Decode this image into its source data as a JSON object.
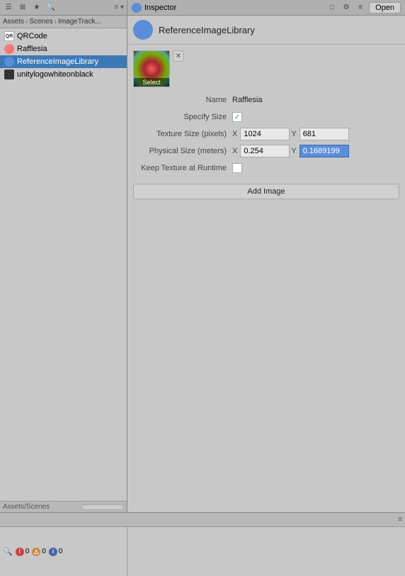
{
  "topBar": {
    "left": {
      "collapseLabel": "≡",
      "menuItems": [
        "☰",
        "⊞",
        "⊟"
      ]
    },
    "right": {
      "tabLabel": "Inspector",
      "tabIcon": "inspector-icon",
      "icons": [
        "□",
        "⚙",
        "≡"
      ],
      "openButton": "Open"
    }
  },
  "leftPanel": {
    "breadcrumb": {
      "parts": [
        "Assets",
        "Scenes",
        "ImageTrack..."
      ]
    },
    "files": [
      {
        "id": "qrcode",
        "name": "QRCode",
        "iconType": "qr",
        "selected": false
      },
      {
        "id": "rafflesia",
        "name": "Rafflesia",
        "iconType": "flower",
        "selected": false
      },
      {
        "id": "reference-image-library",
        "name": "ReferenceImageLibrary",
        "iconType": "lib",
        "selected": true
      },
      {
        "id": "unity-logo",
        "name": "unitylogowhiteonblack",
        "iconType": "unity",
        "selected": false
      }
    ],
    "bottomLabel": "Assets/Scenes"
  },
  "inspector": {
    "title": "ReferenceImageLibrary",
    "iconType": "lib",
    "image": {
      "previewAlt": "Rafflesia flower preview",
      "selectLabel": "Select"
    },
    "fields": {
      "nameLabel": "Name",
      "nameValue": "Rafflesia",
      "specifySizeLabel": "Specify Size",
      "specifySizeChecked": true,
      "textureSizeLabel": "Texture Size (pixels)",
      "textureSizeX": "1024",
      "textureSizeY": "681",
      "physicalSizeLabel": "Physical Size (meters)",
      "physicalSizeX": "0.254",
      "physicalSizeY": "0.1689199",
      "keepTextureLabel": "Keep Texture at Runtime",
      "keepTextureChecked": false
    },
    "addImageButton": "Add Image"
  },
  "bottomPanel": {
    "errors": "0",
    "warnings": "0",
    "info": "0",
    "collapseIcon": "≡"
  }
}
